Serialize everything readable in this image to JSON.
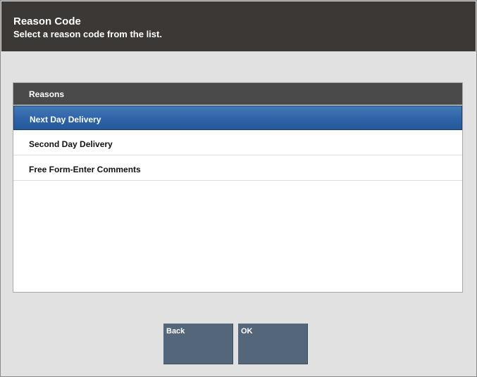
{
  "header": {
    "title": "Reason Code",
    "subtitle": "Select a reason code from the list."
  },
  "list": {
    "column_header": "Reasons",
    "items": [
      {
        "label": "Next Day Delivery",
        "selected": true
      },
      {
        "label": "Second Day Delivery",
        "selected": false
      },
      {
        "label": "Free Form-Enter Comments",
        "selected": false
      }
    ]
  },
  "buttons": {
    "back_label": "Back",
    "ok_label": "OK"
  },
  "colors": {
    "header_bg": "#3b3835",
    "selected_row": "#2e64a8",
    "button_bg": "#546679"
  }
}
